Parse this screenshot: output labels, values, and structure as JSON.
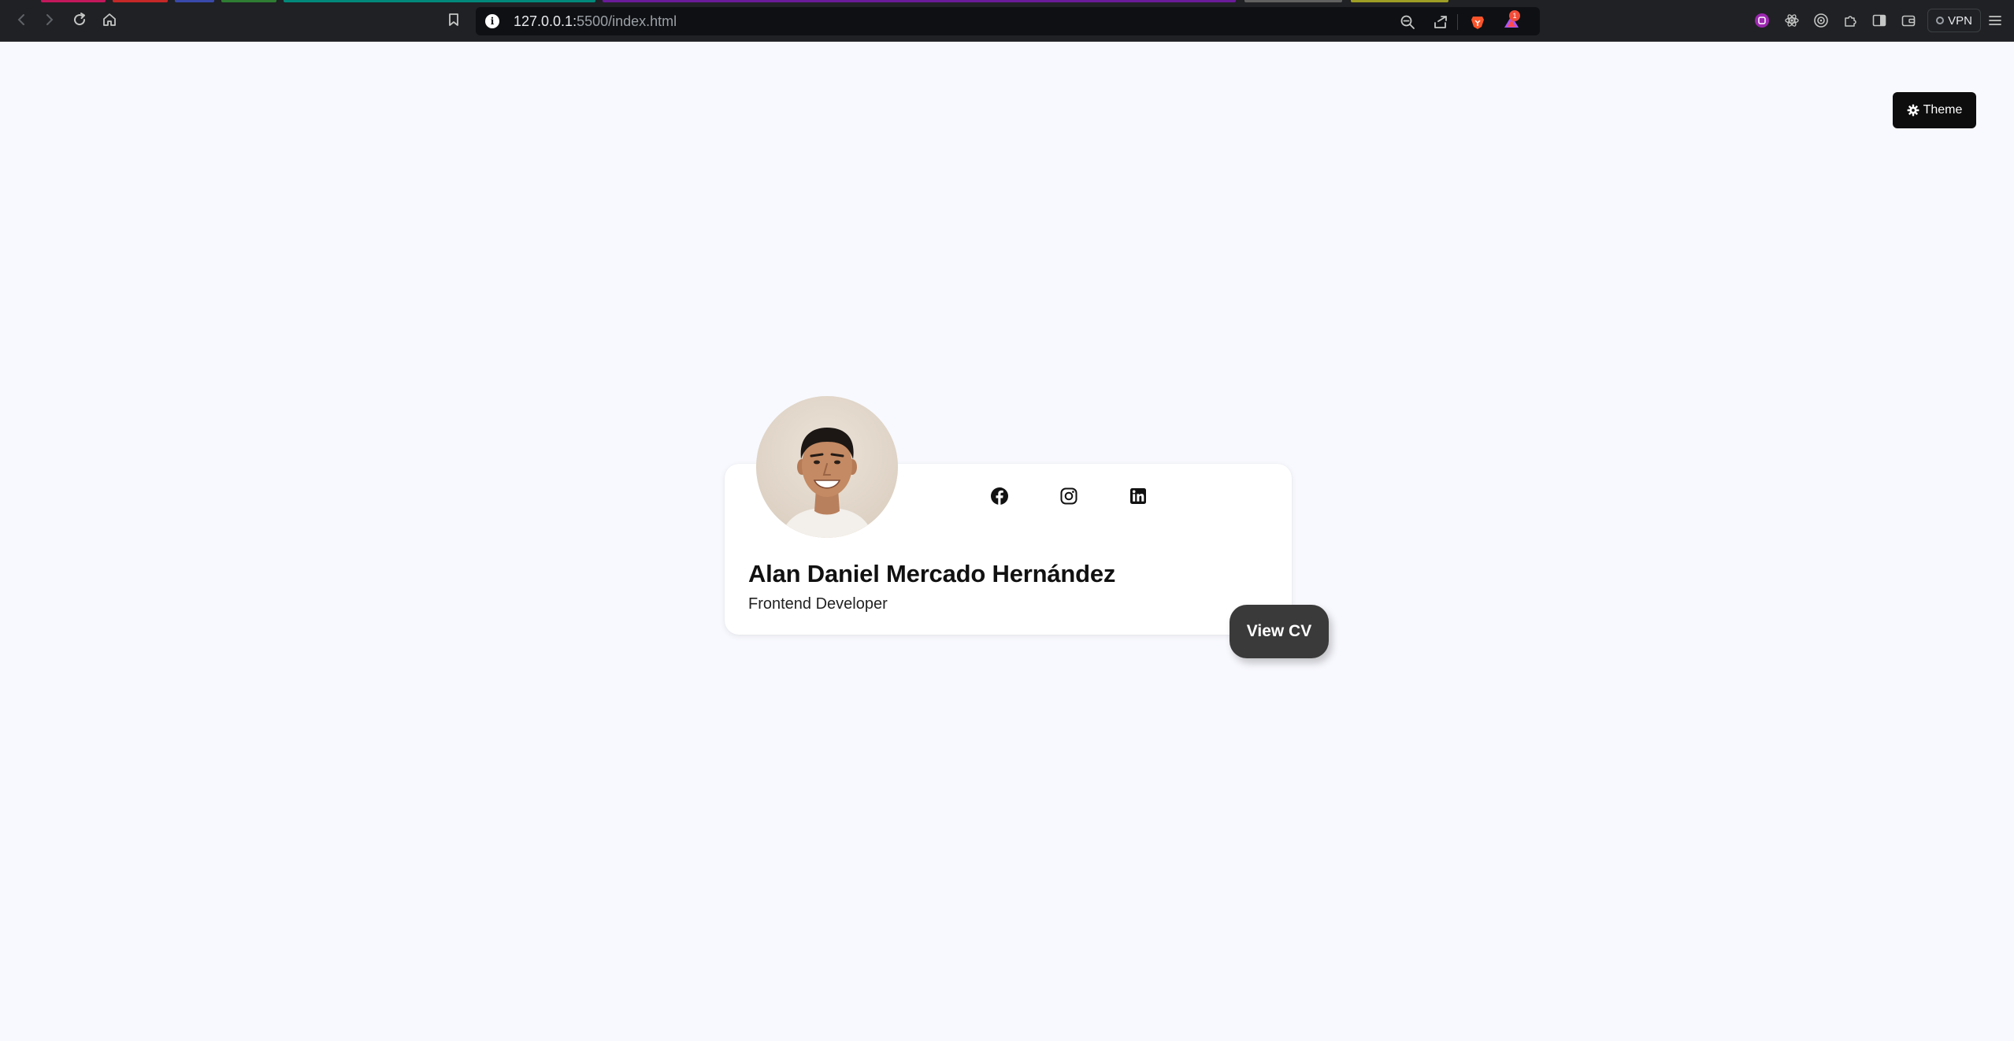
{
  "browser": {
    "url_host": "127.0.0.1:",
    "url_rest": "5500/index.html",
    "notification_count": "1",
    "vpn_label": "VPN"
  },
  "page": {
    "theme_button_label": "Theme",
    "profile": {
      "name": "Alan Daniel Mercado Hernández",
      "role": "Frontend Developer",
      "cv_button_label": "View CV",
      "socials": [
        "facebook-icon",
        "instagram-icon",
        "linkedin-icon"
      ]
    }
  },
  "colors": {
    "page_background": "#f8f9fe",
    "card_background": "#ffffff",
    "cv_button": "#3a3a3a",
    "theme_button": "#0d0d0d",
    "chrome": "#202124"
  }
}
